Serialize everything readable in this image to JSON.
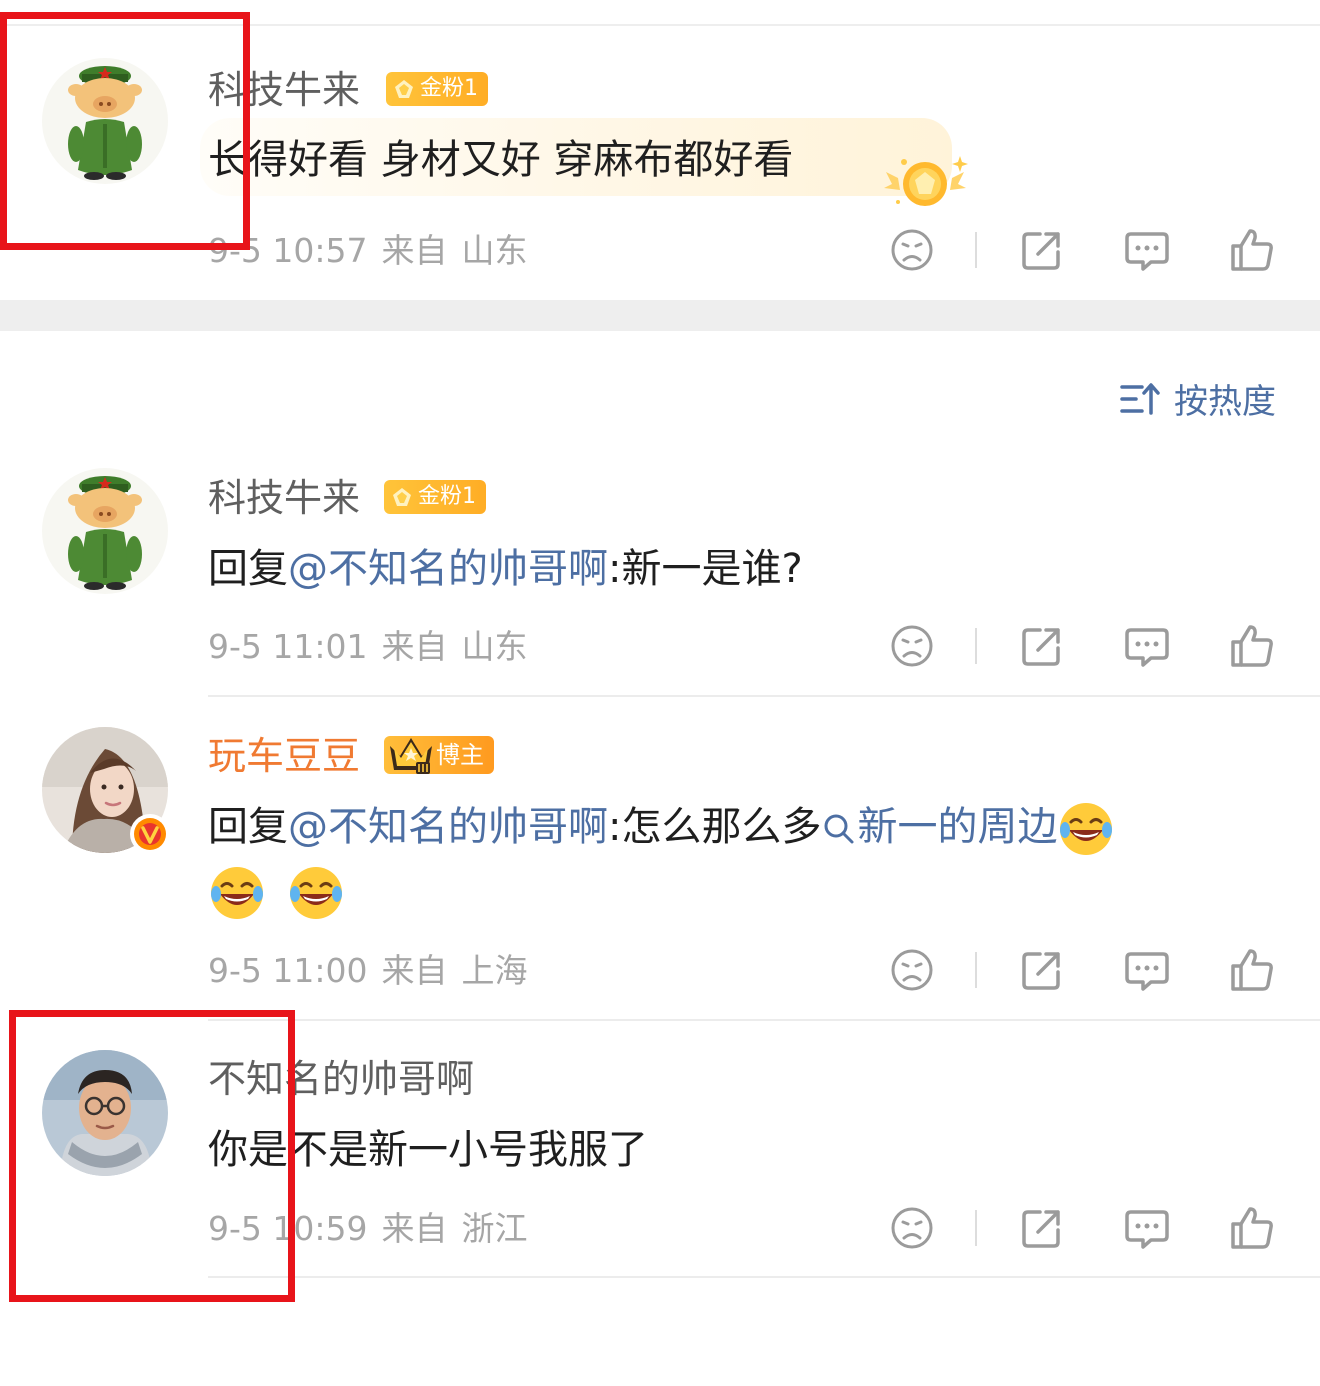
{
  "sort": {
    "label": "按热度"
  },
  "comments": [
    {
      "username": "科技牛来",
      "badge": "金粉1",
      "text": "长得好看 身材又好 穿麻布都好看",
      "time": "9-5 10:57",
      "from": "来自",
      "location": "山东"
    },
    {
      "username": "科技牛来",
      "badge": "金粉1",
      "reply_prefix": "回复",
      "mention": "@不知名的帅哥啊",
      "text": ":新一是谁?",
      "time": "9-5 11:01",
      "from": "来自",
      "location": "山东"
    },
    {
      "username": "玩车豆豆",
      "badge": "博主",
      "reply_prefix": "回复",
      "mention": "@不知名的帅哥啊",
      "text": ":怎么那么多",
      "topic": "新一的周边",
      "time": "9-5 11:00",
      "from": "来自",
      "location": "上海"
    },
    {
      "username": "不知名的帅哥啊",
      "text": "你是不是新一小号我服了",
      "time": "9-5 10:59",
      "from": "来自",
      "location": "浙江"
    }
  ],
  "colors": {
    "highlight_box": "#e8141a",
    "link": "#4d6fa3",
    "vip_name": "#f07a32",
    "badge_gold": "#ffb52e"
  }
}
